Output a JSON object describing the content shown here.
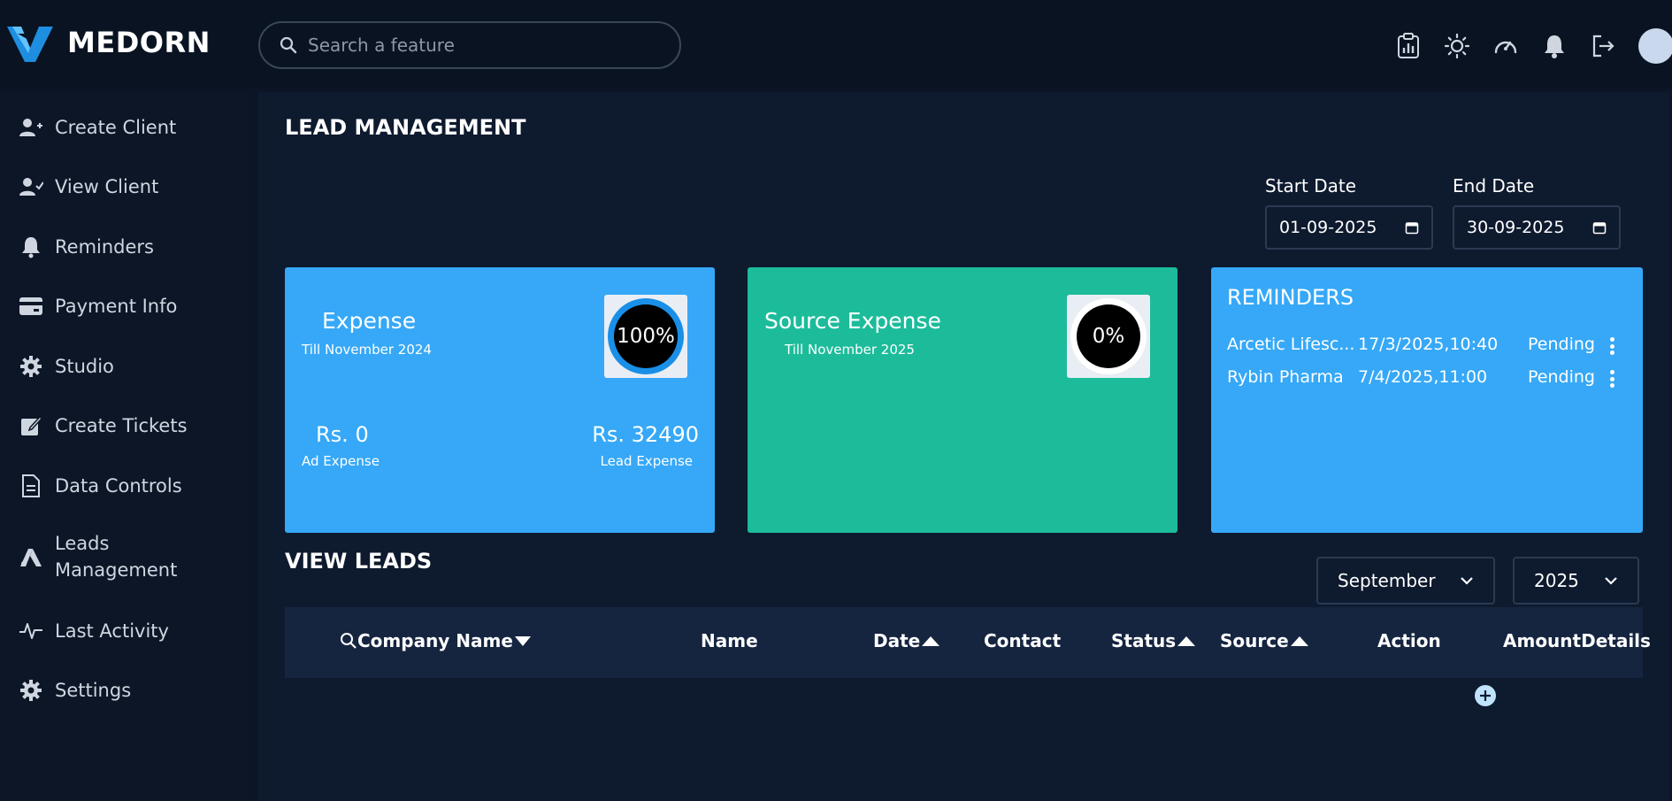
{
  "brand": {
    "name": "MEDORN"
  },
  "search": {
    "placeholder": "Search a feature"
  },
  "topbar_icons": [
    "clipboard-chart-icon",
    "sun-icon",
    "speedometer-icon",
    "bell-icon",
    "logout-icon"
  ],
  "sidebar": {
    "items": [
      {
        "label": "Create Client",
        "icon": "user-plus-icon"
      },
      {
        "label": "View Client",
        "icon": "user-check-icon"
      },
      {
        "label": "Reminders",
        "icon": "bell-icon"
      },
      {
        "label": "Payment Info",
        "icon": "credit-card-icon"
      },
      {
        "label": "Studio",
        "icon": "gear-icon"
      },
      {
        "label": "Create Tickets",
        "icon": "edit-icon"
      },
      {
        "label": "Data Controls",
        "icon": "document-icon"
      },
      {
        "label": "Leads Management",
        "icon": "a-logo-icon"
      },
      {
        "label": "Last Activity",
        "icon": "activity-icon"
      },
      {
        "label": "Settings",
        "icon": "gear-icon"
      }
    ]
  },
  "main": {
    "title": "LEAD MANAGEMENT",
    "start_date": {
      "label": "Start Date",
      "value": "01-09-2025"
    },
    "end_date": {
      "label": "End Date",
      "value": "30-09-2025"
    },
    "expense_card": {
      "title": "Expense",
      "subtitle": "Till November 2024",
      "percent_label": "100%",
      "percent_value": 100,
      "ad_value": "Rs. 0",
      "ad_label": "Ad Expense",
      "lead_value": "Rs. 32490",
      "lead_label": "Lead Expense",
      "color": "#36a8f7"
    },
    "source_card": {
      "title": "Source Expense",
      "subtitle": "Till November 2025",
      "percent_label": "0%",
      "percent_value": 0,
      "color": "#1cbc9b"
    },
    "reminders": {
      "title": "REMINDERS",
      "rows": [
        {
          "company": "Arcetic Lifesc...",
          "datetime": "17/3/2025,10:40",
          "status": "Pending"
        },
        {
          "company": "Rybin Pharma",
          "datetime": "7/4/2025,11:00",
          "status": "Pending"
        }
      ]
    },
    "view_leads": {
      "title": "VIEW LEADS",
      "month": "September",
      "year": "2025",
      "columns": [
        "Company Name",
        "Name",
        "Date",
        "Contact",
        "Status",
        "Source",
        "Action",
        "AmountDetails"
      ]
    }
  },
  "colors": {
    "background": "#0b1526",
    "panel": "#0e1a2e",
    "accent_blue": "#36a8f7",
    "accent_green": "#1cbc9b",
    "table_header": "#152540"
  }
}
